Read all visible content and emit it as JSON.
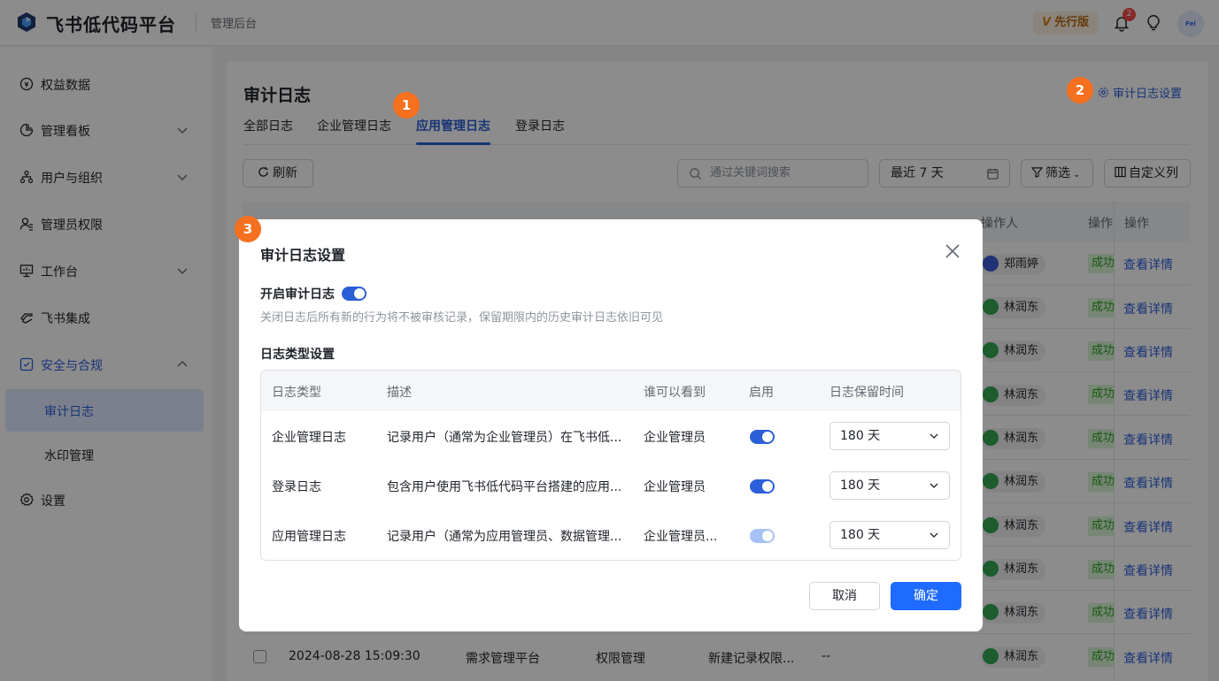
{
  "brand": {
    "name": "飞书低代码平台",
    "section": "管理后台"
  },
  "topbar": {
    "edition_mark": "V",
    "edition": "先行版",
    "notification_count": "2",
    "avatar_text": "Fei"
  },
  "sidebar": {
    "items": [
      {
        "label": "权益数据",
        "icon": "coin-icon"
      },
      {
        "label": "管理看板",
        "icon": "chart-pie-icon"
      },
      {
        "label": "用户与组织",
        "icon": "org-icon"
      },
      {
        "label": "管理员权限",
        "icon": "admin-icon"
      },
      {
        "label": "工作台",
        "icon": "workbench-icon"
      },
      {
        "label": "飞书集成",
        "icon": "integration-icon"
      },
      {
        "label": "安全与合规",
        "icon": "shield-icon"
      },
      {
        "label": "设置",
        "icon": "gear-icon"
      }
    ],
    "subitems": [
      "审计日志",
      "水印管理"
    ]
  },
  "page": {
    "title": "审计日志",
    "tabs": [
      "全部日志",
      "企业管理日志",
      "应用管理日志",
      "登录日志"
    ],
    "settings_link": "审计日志设置",
    "markers": [
      "1",
      "2",
      "3"
    ]
  },
  "toolbar": {
    "refresh": "刷新",
    "search_placeholder": "通过关键词搜索",
    "date_range": "最近 7 天",
    "filter": "筛选",
    "custom_columns": "自定义列"
  },
  "table": {
    "headers": {
      "operator": "操作人",
      "action": "操作",
      "action2": "操作"
    },
    "rows": [
      {
        "person": "郑雨婷",
        "status": "成功",
        "detail": "查看详情"
      },
      {
        "person": "林润东",
        "status": "成功",
        "detail": "查看详情"
      },
      {
        "person": "林润东",
        "status": "成功",
        "detail": "查看详情"
      },
      {
        "person": "林润东",
        "status": "成功",
        "detail": "查看详情"
      },
      {
        "person": "林润东",
        "status": "成功",
        "detail": "查看详情"
      },
      {
        "person": "林润东",
        "status": "成功",
        "detail": "查看详情"
      },
      {
        "person": "林润东",
        "status": "成功",
        "detail": "查看详情"
      },
      {
        "person": "林润东",
        "status": "成功",
        "detail": "查看详情"
      },
      {
        "person": "林润东",
        "status": "成功",
        "detail": "查看详情"
      }
    ],
    "last_row": {
      "time": "2024-08-28 15:09:30",
      "app": "需求管理平台",
      "module": "权限管理",
      "event": "新建记录权限...",
      "request": "--"
    }
  },
  "dialog": {
    "title": "审计日志设置",
    "enable_label": "开启审计日志",
    "enable_hint": "关闭日志后所有新的行为将不被审核记录，保留期限内的历史审计日志依旧可见",
    "type_section": "日志类型设置",
    "columns": [
      "日志类型",
      "描述",
      "谁可以看到",
      "启用",
      "日志保留时间"
    ],
    "rows": [
      {
        "type": "企业管理日志",
        "desc": "记录用户（通常为企业管理员）在飞书低...",
        "visible": "企业管理员",
        "enabled": true,
        "retention": "180 天"
      },
      {
        "type": "登录日志",
        "desc": "包含用户使用飞书低代码平台搭建的应用...",
        "visible": "企业管理员",
        "enabled": true,
        "retention": "180 天"
      },
      {
        "type": "应用管理日志",
        "desc": "记录用户（通常为应用管理员、数据管理...",
        "visible": "企业管理员...",
        "enabled": true,
        "retention": "180 天"
      }
    ],
    "cancel": "取消",
    "confirm": "确定"
  },
  "colors": {
    "accent": "#2b5fd9",
    "primary_button": "#1f6bff",
    "marker": "#f5701f",
    "success": "#2ea121"
  }
}
